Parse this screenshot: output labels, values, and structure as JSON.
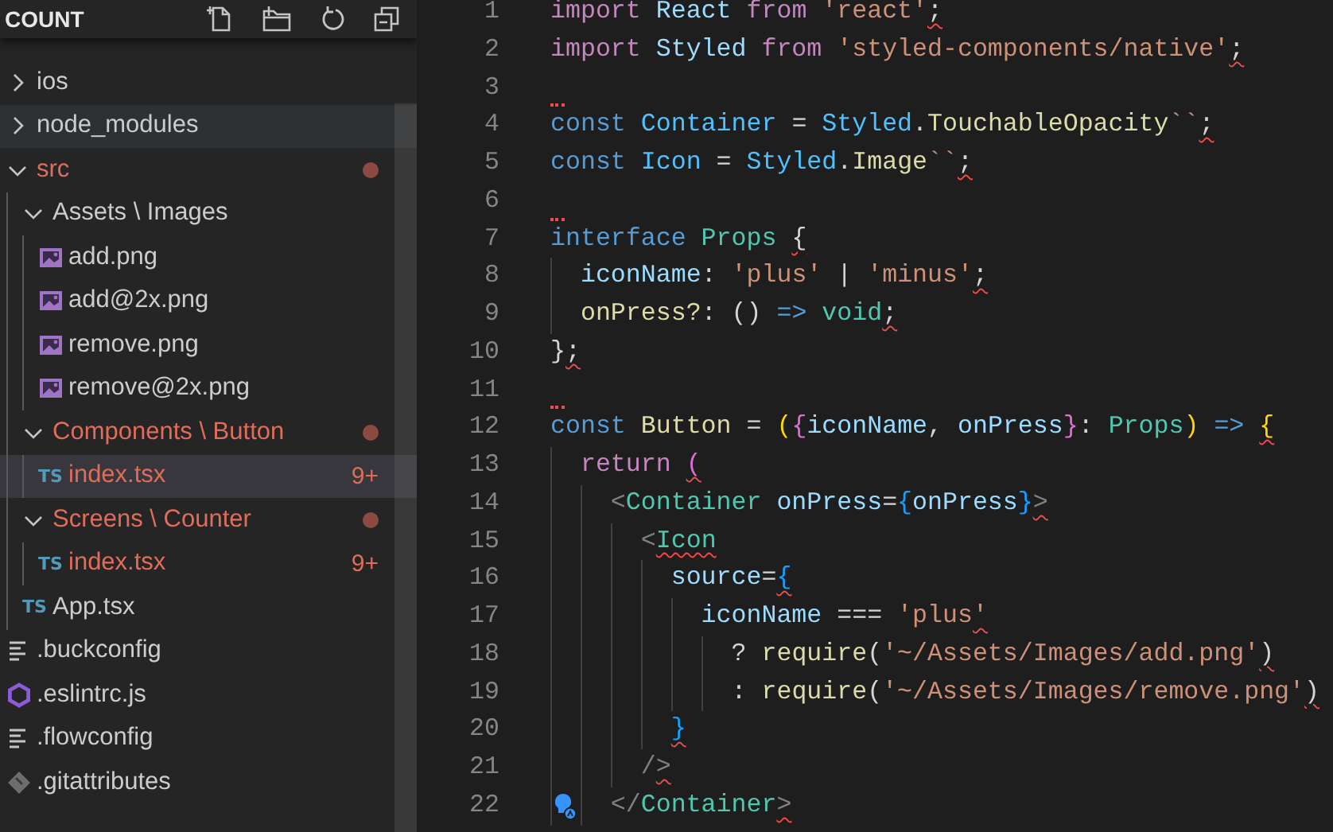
{
  "sidebar": {
    "title": "COUNT",
    "tree": [
      {
        "kind": "folder",
        "name": "ios",
        "expanded": false,
        "modified": false,
        "selected": false,
        "hovered": false
      },
      {
        "kind": "folder",
        "name": "node_modules",
        "expanded": false,
        "modified": false,
        "selected": false,
        "hovered": true
      },
      {
        "kind": "folder",
        "name": "src",
        "expanded": true,
        "modified": true,
        "selected": false,
        "hovered": false,
        "children": [
          {
            "kind": "folder",
            "name": "Assets \\ Images",
            "expanded": true,
            "modified": false,
            "selected": false,
            "hovered": false,
            "children": [
              {
                "kind": "image",
                "name": "add.png",
                "modified": false,
                "selected": false,
                "hovered": false
              },
              {
                "kind": "image",
                "name": "add@2x.png",
                "modified": false,
                "selected": false,
                "hovered": false
              },
              {
                "kind": "image",
                "name": "remove.png",
                "modified": false,
                "selected": false,
                "hovered": false
              },
              {
                "kind": "image",
                "name": "remove@2x.png",
                "modified": false,
                "selected": false,
                "hovered": false
              }
            ]
          },
          {
            "kind": "folder",
            "name": "Components \\ Button",
            "expanded": true,
            "modified": true,
            "selected": false,
            "hovered": false,
            "children": [
              {
                "kind": "ts",
                "icon_label": "TS",
                "name": "index.tsx",
                "modified": true,
                "badge": "9+",
                "selected": true,
                "hovered": false
              }
            ]
          },
          {
            "kind": "folder",
            "name": "Screens \\ Counter",
            "expanded": true,
            "modified": true,
            "selected": false,
            "hovered": false,
            "children": [
              {
                "kind": "ts",
                "icon_label": "TS",
                "name": "index.tsx",
                "modified": true,
                "badge": "9+",
                "selected": false,
                "hovered": false
              }
            ]
          },
          {
            "kind": "ts",
            "icon_label": "TS",
            "name": "App.tsx",
            "modified": false,
            "selected": false,
            "hovered": false
          }
        ]
      },
      {
        "kind": "text",
        "name": ".buckconfig",
        "modified": false,
        "selected": false,
        "hovered": false
      },
      {
        "kind": "eslint",
        "name": ".eslintrc.js",
        "modified": false,
        "selected": false,
        "hovered": false
      },
      {
        "kind": "text",
        "name": ".flowconfig",
        "modified": false,
        "selected": false,
        "hovered": false
      },
      {
        "kind": "git",
        "name": ".gitattributes",
        "modified": false,
        "selected": false,
        "hovered": false
      }
    ]
  },
  "editor": {
    "lines": [
      {
        "number": "1",
        "error": true,
        "lightbulb": false,
        "segments": [
          {
            "t": "import ",
            "color": "#c586c0"
          },
          {
            "t": "React ",
            "color": "#9cdcfe"
          },
          {
            "t": "from ",
            "color": "#c586c0"
          },
          {
            "t": "'react'",
            "color": "#ce9178"
          },
          {
            "t": ";",
            "color": "#d4d4d4"
          }
        ]
      },
      {
        "number": "2",
        "error": true,
        "lightbulb": false,
        "segments": [
          {
            "t": "import ",
            "color": "#c586c0"
          },
          {
            "t": "Styled ",
            "color": "#9cdcfe"
          },
          {
            "t": "from ",
            "color": "#c586c0"
          },
          {
            "t": "'styled-components/native'",
            "color": "#ce9178"
          },
          {
            "t": ";",
            "color": "#d4d4d4"
          }
        ]
      },
      {
        "number": "3",
        "error": true,
        "lightbulb": false
      },
      {
        "number": "4",
        "error": true,
        "lightbulb": false,
        "segments": [
          {
            "t": "const ",
            "color": "#569cd6"
          },
          {
            "t": "Container ",
            "color": "#4fc1ff"
          },
          {
            "t": "= ",
            "color": "#d4d4d4"
          },
          {
            "t": "Styled",
            "color": "#4fc1ff"
          },
          {
            "t": ".",
            "color": "#d4d4d4"
          },
          {
            "t": "TouchableOpacity",
            "color": "#dcdcaa"
          },
          {
            "t": "``",
            "color": "#ce9178"
          },
          {
            "t": ";",
            "color": "#d4d4d4"
          }
        ]
      },
      {
        "number": "5",
        "error": true,
        "lightbulb": false,
        "segments": [
          {
            "t": "const ",
            "color": "#569cd6"
          },
          {
            "t": "Icon ",
            "color": "#4fc1ff"
          },
          {
            "t": "= ",
            "color": "#d4d4d4"
          },
          {
            "t": "Styled",
            "color": "#4fc1ff"
          },
          {
            "t": ".",
            "color": "#d4d4d4"
          },
          {
            "t": "Image",
            "color": "#dcdcaa"
          },
          {
            "t": "``",
            "color": "#ce9178"
          },
          {
            "t": ";",
            "color": "#d4d4d4"
          }
        ]
      },
      {
        "number": "6",
        "error": true,
        "lightbulb": false
      },
      {
        "number": "7",
        "error": true,
        "lightbulb": false,
        "segments": [
          {
            "t": "interface ",
            "color": "#569cd6"
          },
          {
            "t": "Props ",
            "color": "#4ec9b0"
          },
          {
            "t": "{",
            "color": "#d4d4d4"
          }
        ]
      },
      {
        "number": "8",
        "error": true,
        "lightbulb": false,
        "segments": [
          {
            "t": "  iconName",
            "color": "#9cdcfe"
          },
          {
            "t": ": ",
            "color": "#d4d4d4"
          },
          {
            "t": "'plus' ",
            "color": "#ce9178"
          },
          {
            "t": "| ",
            "color": "#d4d4d4"
          },
          {
            "t": "'minus'",
            "color": "#ce9178"
          },
          {
            "t": ";",
            "color": "#d4d4d4"
          }
        ]
      },
      {
        "number": "9",
        "error": true,
        "lightbulb": false,
        "segments": [
          {
            "t": "  onPress?",
            "color": "#dcdcaa"
          },
          {
            "t": ": () ",
            "color": "#d4d4d4"
          },
          {
            "t": "=> ",
            "color": "#569cd6"
          },
          {
            "t": "void",
            "color": "#4ec9b0"
          },
          {
            "t": ";",
            "color": "#d4d4d4"
          }
        ]
      },
      {
        "number": "10",
        "error": true,
        "lightbulb": false,
        "segments": [
          {
            "t": "}",
            "color": "#d4d4d4"
          },
          {
            "t": ";",
            "color": "#d4d4d4"
          }
        ]
      },
      {
        "number": "11",
        "error": true,
        "lightbulb": false
      },
      {
        "number": "12",
        "error": true,
        "lightbulb": false,
        "segments": [
          {
            "t": "const ",
            "color": "#569cd6"
          },
          {
            "t": "Button ",
            "color": "#dcdcaa"
          },
          {
            "t": "= ",
            "color": "#d4d4d4"
          },
          {
            "t": "(",
            "color": "#ffd700"
          },
          {
            "t": "{",
            "color": "#da70d6"
          },
          {
            "t": "iconName",
            "color": "#9cdcfe"
          },
          {
            "t": ", ",
            "color": "#d4d4d4"
          },
          {
            "t": "onPress",
            "color": "#9cdcfe"
          },
          {
            "t": "}",
            "color": "#da70d6"
          },
          {
            "t": ": ",
            "color": "#d4d4d4"
          },
          {
            "t": "Props",
            "color": "#4ec9b0"
          },
          {
            "t": ") ",
            "color": "#ffd700"
          },
          {
            "t": "=> ",
            "color": "#569cd6"
          },
          {
            "t": "{",
            "color": "#ffd700"
          }
        ]
      },
      {
        "number": "13",
        "error": true,
        "lightbulb": false,
        "segments": [
          {
            "t": "  return ",
            "color": "#c586c0"
          },
          {
            "t": "(",
            "color": "#da70d6"
          }
        ]
      },
      {
        "number": "14",
        "error": true,
        "lightbulb": false,
        "segments": [
          {
            "t": "    <",
            "color": "#808080"
          },
          {
            "t": "Container ",
            "color": "#4ec9b0"
          },
          {
            "t": "onPress",
            "color": "#9cdcfe"
          },
          {
            "t": "=",
            "color": "#d4d4d4"
          },
          {
            "t": "{",
            "color": "#179fff"
          },
          {
            "t": "onPress",
            "color": "#9cdcfe"
          },
          {
            "t": "}",
            "color": "#179fff"
          },
          {
            "t": ">",
            "color": "#808080"
          }
        ]
      },
      {
        "number": "15",
        "error": true,
        "lightbulb": false,
        "segments": [
          {
            "t": "      <",
            "color": "#808080"
          },
          {
            "t": "Icon",
            "color": "#4ec9b0"
          }
        ]
      },
      {
        "number": "16",
        "error": true,
        "lightbulb": false,
        "segments": [
          {
            "t": "        source",
            "color": "#9cdcfe"
          },
          {
            "t": "=",
            "color": "#d4d4d4"
          },
          {
            "t": "{",
            "color": "#179fff"
          }
        ]
      },
      {
        "number": "17",
        "error": true,
        "lightbulb": false,
        "segments": [
          {
            "t": "          iconName ",
            "color": "#9cdcfe"
          },
          {
            "t": "=== ",
            "color": "#d4d4d4"
          },
          {
            "t": "'plus",
            "color": "#ce9178"
          },
          {
            "t": "'",
            "color": "#ce9178"
          }
        ]
      },
      {
        "number": "18",
        "error": true,
        "lightbulb": false,
        "segments": [
          {
            "t": "            ? ",
            "color": "#d4d4d4"
          },
          {
            "t": "require",
            "color": "#dcdcaa"
          },
          {
            "t": "(",
            "color": "#d4d4d4"
          },
          {
            "t": "'~/Assets/Images/add.png'",
            "color": "#ce9178"
          },
          {
            "t": ")",
            "color": "#d4d4d4"
          }
        ]
      },
      {
        "number": "19",
        "error": true,
        "lightbulb": false,
        "segments": [
          {
            "t": "            : ",
            "color": "#d4d4d4"
          },
          {
            "t": "require",
            "color": "#dcdcaa"
          },
          {
            "t": "(",
            "color": "#d4d4d4"
          },
          {
            "t": "'~/Assets/Images/remove.png'",
            "color": "#ce9178"
          },
          {
            "t": ")",
            "color": "#d4d4d4"
          }
        ]
      },
      {
        "number": "20",
        "error": true,
        "lightbulb": false,
        "segments": [
          {
            "t": "        }",
            "color": "#179fff"
          }
        ]
      },
      {
        "number": "21",
        "error": true,
        "lightbulb": false,
        "segments": [
          {
            "t": "      /",
            "color": "#808080"
          },
          {
            "t": ">",
            "color": "#808080"
          }
        ]
      },
      {
        "number": "22",
        "error": true,
        "lightbulb": true,
        "segments": [
          {
            "t": "    </",
            "color": "#808080"
          },
          {
            "t": "Container",
            "color": "#4ec9b0"
          },
          {
            "t": ">",
            "color": "#808080"
          }
        ]
      }
    ]
  }
}
